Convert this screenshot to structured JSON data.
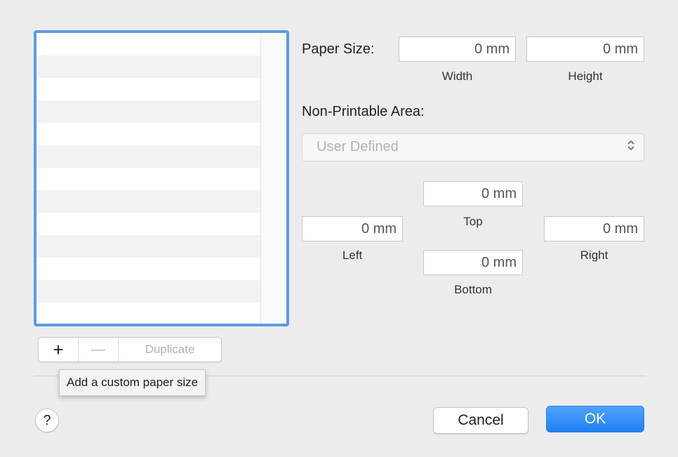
{
  "paper_size": {
    "label": "Paper Size:",
    "width_value": "0 mm",
    "width_label": "Width",
    "height_value": "0 mm",
    "height_label": "Height"
  },
  "non_printable": {
    "label": "Non-Printable Area:",
    "popup_value": "User Defined",
    "popup_arrows": "⌃⌄",
    "top_value": "0 mm",
    "top_label": "Top",
    "left_value": "0 mm",
    "left_label": "Left",
    "right_value": "0 mm",
    "right_label": "Right",
    "bottom_value": "0 mm",
    "bottom_label": "Bottom"
  },
  "list_controls": {
    "add_label": "+",
    "remove_label": "—",
    "duplicate_label": "Duplicate",
    "tooltip": "Add a custom paper size"
  },
  "footer": {
    "help_label": "?",
    "cancel_label": "Cancel",
    "ok_label": "OK"
  },
  "colors": {
    "accent": "#1f80f2",
    "focus_ring": "#5b9be6"
  }
}
